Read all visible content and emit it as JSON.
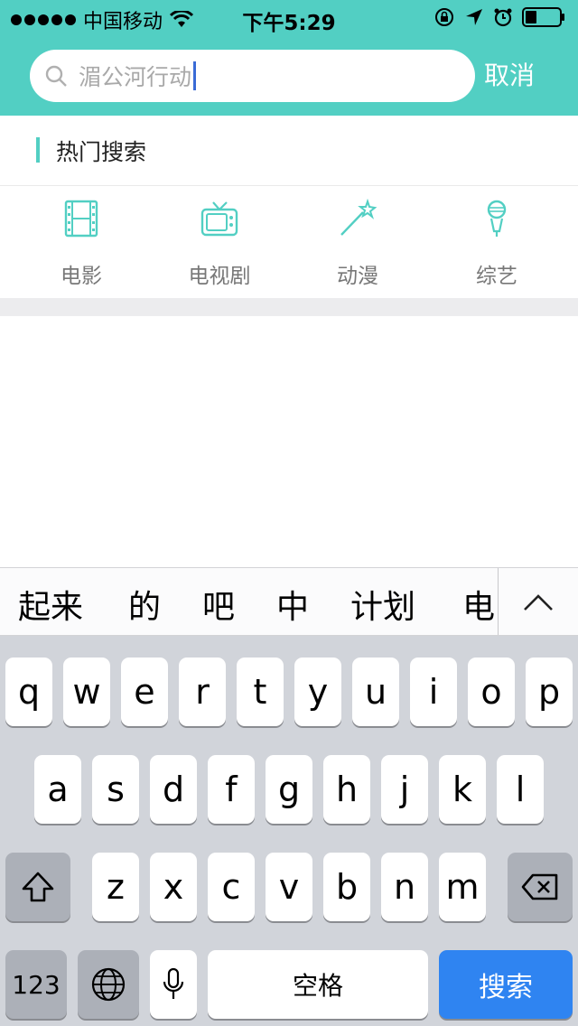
{
  "status_bar": {
    "carrier": "中国移动",
    "time": "下午5:29"
  },
  "search": {
    "placeholder": "湄公河行动",
    "cancel_label": "取消"
  },
  "hot_search": {
    "title": "热门搜索",
    "categories": [
      {
        "label": "电影",
        "icon": "film-icon"
      },
      {
        "label": "电视剧",
        "icon": "tv-icon"
      },
      {
        "label": "动漫",
        "icon": "magic-wand-icon"
      },
      {
        "label": "综艺",
        "icon": "microphone-icon"
      }
    ]
  },
  "keyboard": {
    "candidates": [
      "起来",
      "的",
      "吧",
      "中",
      "计划",
      "电"
    ],
    "row1": [
      "q",
      "w",
      "e",
      "r",
      "t",
      "y",
      "u",
      "i",
      "o",
      "p"
    ],
    "row2": [
      "a",
      "s",
      "d",
      "f",
      "g",
      "h",
      "j",
      "k",
      "l"
    ],
    "row3": [
      "z",
      "x",
      "c",
      "v",
      "b",
      "n",
      "m"
    ],
    "numbers_label": "123",
    "space_label": "空格",
    "search_label": "搜索"
  },
  "colors": {
    "accent": "#52cfc3",
    "keyboard_bg": "#d1d4da",
    "search_key": "#2f84f1"
  }
}
